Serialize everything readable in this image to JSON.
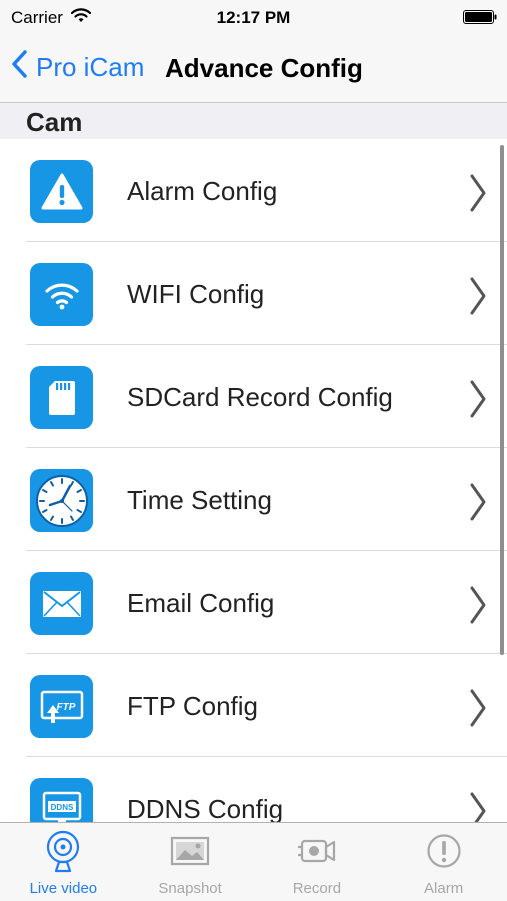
{
  "status_bar": {
    "carrier": "Carrier",
    "time": "12:17 PM",
    "wifi_icon": "wifi-icon",
    "battery_icon": "battery-icon"
  },
  "nav": {
    "back_label": "Pro iCam",
    "title": "Advance Config"
  },
  "section": {
    "title": "Cam"
  },
  "items": [
    {
      "label": "Alarm Config",
      "icon": "warning-icon"
    },
    {
      "label": "WIFI Config",
      "icon": "wifi-icon"
    },
    {
      "label": "SDCard Record Config",
      "icon": "sdcard-icon"
    },
    {
      "label": "Time Setting",
      "icon": "clock-icon"
    },
    {
      "label": "Email Config",
      "icon": "envelope-icon"
    },
    {
      "label": "FTP Config",
      "icon": "ftp-icon",
      "badge": "FTP"
    },
    {
      "label": "DDNS Config",
      "icon": "ddns-icon",
      "badge": "DDNS"
    }
  ],
  "tabs": [
    {
      "label": "Live video",
      "icon": "webcam-icon",
      "active": true
    },
    {
      "label": "Snapshot",
      "icon": "picture-icon",
      "active": false
    },
    {
      "label": "Record",
      "icon": "video-camera-icon",
      "active": false
    },
    {
      "label": "Alarm",
      "icon": "alert-icon",
      "active": false
    }
  ],
  "colors": {
    "accent": "#1f7cf6",
    "icon_background": "#1796e6",
    "inactive_tab": "#a7a7a7",
    "section_background": "#efeff4"
  }
}
